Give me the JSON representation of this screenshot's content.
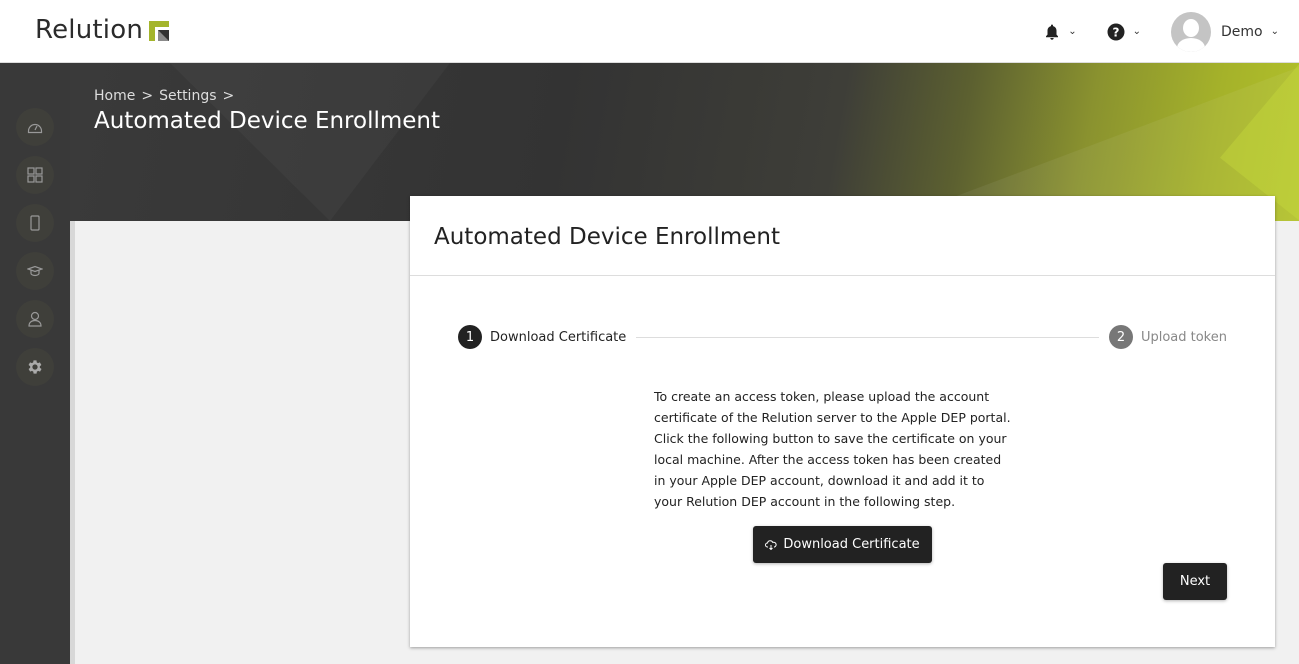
{
  "app": {
    "logo_text": "Relution"
  },
  "topbar": {
    "notifications_icon": "bell-icon",
    "help_icon": "question-circle-icon",
    "user_name": "Demo"
  },
  "sidebar": {
    "items": [
      {
        "icon": "dashboard-gauge-icon",
        "label": "Dashboard"
      },
      {
        "icon": "apps-grid-icon",
        "label": "Apps"
      },
      {
        "icon": "device-phone-icon",
        "label": "Devices"
      },
      {
        "icon": "education-cap-icon",
        "label": "Education"
      },
      {
        "icon": "user-icon",
        "label": "Users"
      },
      {
        "icon": "gear-icon",
        "label": "Settings"
      }
    ]
  },
  "header": {
    "breadcrumb": [
      "Home",
      "Settings"
    ],
    "separator": ">",
    "title": "Automated Device Enrollment"
  },
  "card": {
    "title": "Automated Device Enrollment",
    "steps": [
      {
        "number": "1",
        "label": "Download Certificate",
        "active": true
      },
      {
        "number": "2",
        "label": "Upload token",
        "active": false
      }
    ],
    "instructions": "To create an access token, please upload the account certificate of the Relution server to the Apple DEP portal. Click the following button to save the certificate on your local machine. After the access token has been created in your Apple DEP account, download it and add it to your Relution DEP account in the following step.",
    "download_button_label": "Download Certificate",
    "next_button_label": "Next"
  },
  "colors": {
    "accent": "#a4b52c",
    "dark": "#222222",
    "sidebar_bg": "#393939",
    "page_bg": "#f1f1f1"
  }
}
